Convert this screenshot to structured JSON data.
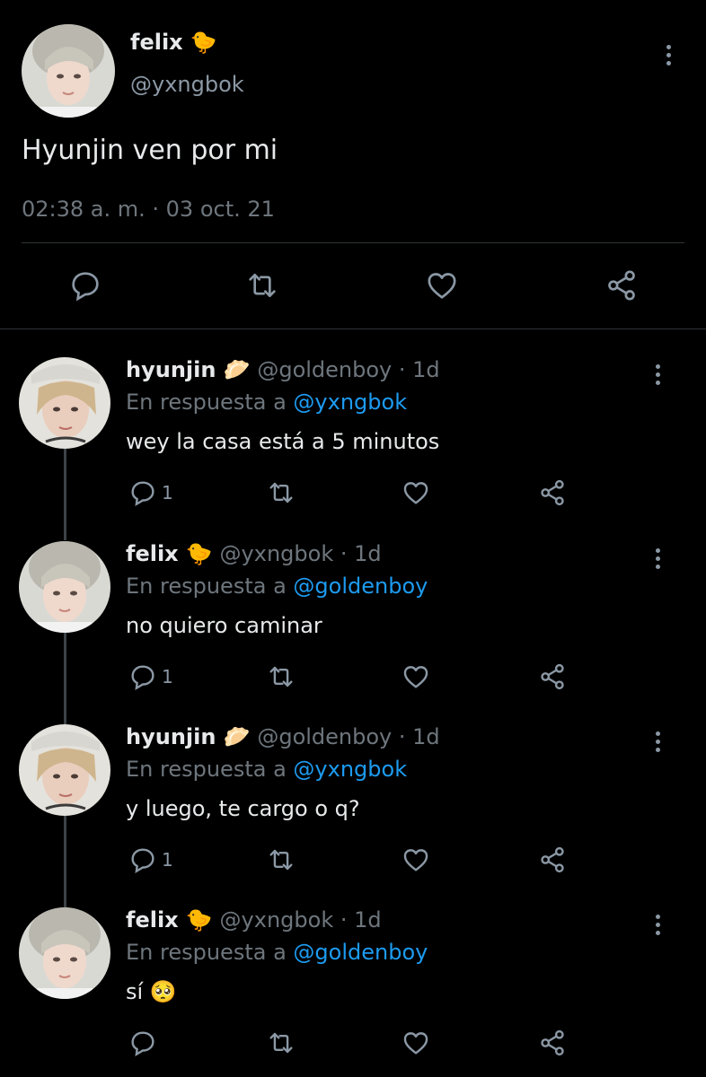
{
  "main_tweet": {
    "name": "felix",
    "name_emoji": "🐤",
    "handle": "@yxngbok",
    "text": "Hyunjin ven por mi",
    "timestamp": "02:38 a. m. · 03 oct. 21"
  },
  "replies": [
    {
      "name": "hyunjin",
      "name_emoji": "🥟",
      "handle": "@goldenboy · 1d",
      "in_reply_label": "En respuesta a",
      "in_reply_to": "@yxngbok",
      "text": "wey la casa está a 5 minutos",
      "reply_count": "1"
    },
    {
      "name": "felix",
      "name_emoji": "🐤",
      "handle": "@yxngbok · 1d",
      "in_reply_label": "En respuesta a",
      "in_reply_to": "@goldenboy",
      "text": "no quiero caminar",
      "reply_count": "1"
    },
    {
      "name": "hyunjin",
      "name_emoji": "🥟",
      "handle": "@goldenboy · 1d",
      "in_reply_label": "En respuesta a",
      "in_reply_to": "@yxngbok",
      "text": "y luego, te cargo o q?",
      "reply_count": "1"
    },
    {
      "name": "felix",
      "name_emoji": "🐤",
      "handle": "@yxngbok · 1d",
      "in_reply_label": "En respuesta a",
      "in_reply_to": "@goldenboy",
      "text": "sí",
      "text_emoji": "🥺",
      "reply_count": ""
    }
  ],
  "colors": {
    "background": "#000000",
    "text": "#e7e9ea",
    "secondary": "#6e767d",
    "link": "#1d9bf0",
    "icon": "#8b98a5"
  },
  "icons": [
    "reply-icon",
    "retweet-icon",
    "like-icon",
    "share-icon",
    "more-icon"
  ]
}
